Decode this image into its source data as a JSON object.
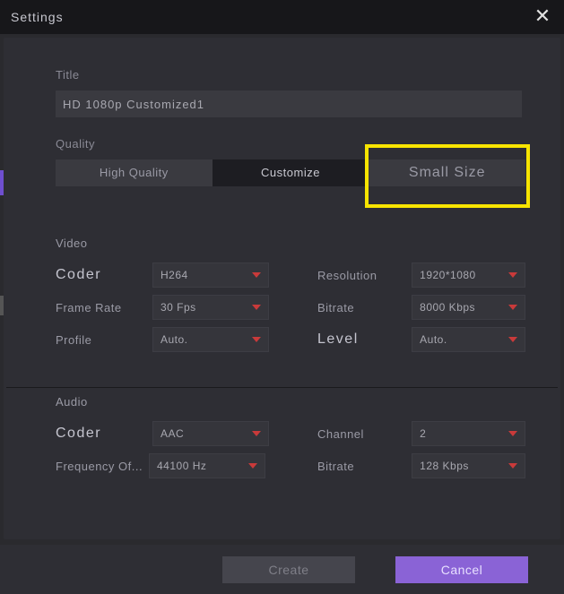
{
  "header": {
    "title": "Settings"
  },
  "title": {
    "label": "Title",
    "value": "HD 1080p Customized1"
  },
  "quality": {
    "label": "Quality",
    "options": {
      "high": "High Quality",
      "customize": "Customize",
      "small": "Small Size"
    }
  },
  "video": {
    "heading": "Video",
    "coder": {
      "label": "Coder",
      "value": "H264"
    },
    "resolution": {
      "label": "Resolution",
      "value": "1920*1080"
    },
    "framerate": {
      "label": "Frame Rate",
      "value": "30 Fps"
    },
    "bitrate": {
      "label": "Bitrate",
      "value": "8000 Kbps"
    },
    "profile": {
      "label": "Profile",
      "value": "Auto."
    },
    "level": {
      "label": "Level",
      "value": "Auto."
    }
  },
  "audio": {
    "heading": "Audio",
    "coder": {
      "label": "Coder",
      "value": "AAC"
    },
    "channel": {
      "label": "Channel",
      "value": "2"
    },
    "frequency": {
      "label": "Frequency Of...",
      "value": "44100 Hz"
    },
    "bitrate": {
      "label": "Bitrate",
      "value": "128 Kbps"
    }
  },
  "footer": {
    "create": "Create",
    "cancel": "Cancel"
  }
}
